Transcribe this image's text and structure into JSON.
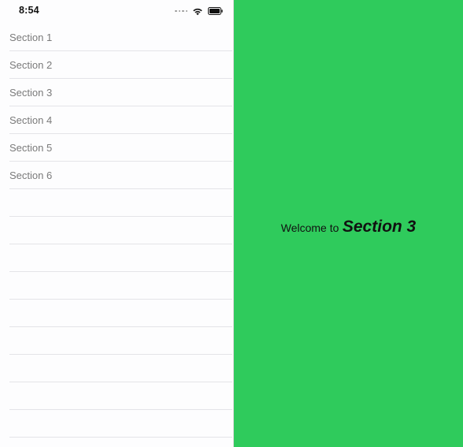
{
  "status_bar": {
    "time": "8:54",
    "icons": [
      "signal-dots-icon",
      "wifi-icon",
      "battery-icon"
    ]
  },
  "table": {
    "rows": [
      {
        "label": "Section 1"
      },
      {
        "label": "Section 2"
      },
      {
        "label": "Section 3"
      },
      {
        "label": "Section 4"
      },
      {
        "label": "Section 5"
      },
      {
        "label": "Section 6"
      },
      {
        "label": ""
      },
      {
        "label": ""
      },
      {
        "label": ""
      },
      {
        "label": ""
      },
      {
        "label": ""
      },
      {
        "label": ""
      },
      {
        "label": ""
      },
      {
        "label": ""
      },
      {
        "label": ""
      }
    ]
  },
  "detail": {
    "welcome_prefix": "Welcome to",
    "section_title": "Section 3",
    "background_color": "#2fcb5c"
  }
}
